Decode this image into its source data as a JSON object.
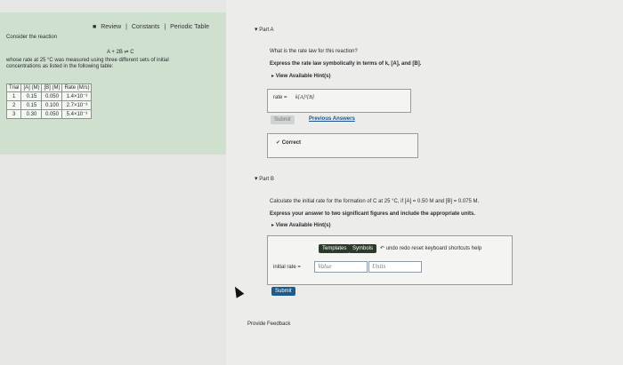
{
  "header": {
    "review_label": "Review",
    "sep": "|",
    "constants_label": "Constants",
    "periodic_label": "Periodic Table"
  },
  "left": {
    "consider": "Consider the reaction",
    "reaction": "A + 2B ⇌ C",
    "desc1": "whose rate at 25 °C was measured using three different sets of initial",
    "desc2": "concentrations as listed in the following table:",
    "table": {
      "headers": [
        "Trial",
        "[A] (M)",
        "[B] (M)",
        "Rate (M/s)"
      ],
      "rows": [
        [
          "1",
          "0.15",
          "0.050",
          "1.4×10⁻³"
        ],
        [
          "2",
          "0.15",
          "0.100",
          "2.7×10⁻³"
        ],
        [
          "3",
          "0.30",
          "0.050",
          "5.4×10⁻³"
        ]
      ]
    }
  },
  "partA": {
    "title": "Part A",
    "question": "What is the rate law for this reaction?",
    "instruction": "Express the rate law symbolically in terms of k, [A], and [B].",
    "hints": "View Available Hint(s)",
    "answer_label": "rate =",
    "answer_value": "k[A]²[B]",
    "submit_label": "Submit",
    "previous_answers": "Previous Answers",
    "feedback": "Correct"
  },
  "partB": {
    "title": "Part B",
    "question": "Calculate the initial rate for the formation of C at 25 °C, if [A] = 0.50 M and [B] = 0.075 M.",
    "instruction": "Express your answer to two significant figures and include the appropriate units.",
    "hints": "View Available Hint(s)",
    "toolbar": {
      "templates": "Templates",
      "symbols": "Symbols",
      "undo": "undo",
      "redo": "redo",
      "reset": "reset",
      "shortcuts": "keyboard shortcuts",
      "help": "help"
    },
    "field_label": "initial rate =",
    "value_placeholder": "Value",
    "units_placeholder": "Units",
    "submit_label": "Submit"
  },
  "footer": {
    "feedback_link": "Provide Feedback"
  }
}
